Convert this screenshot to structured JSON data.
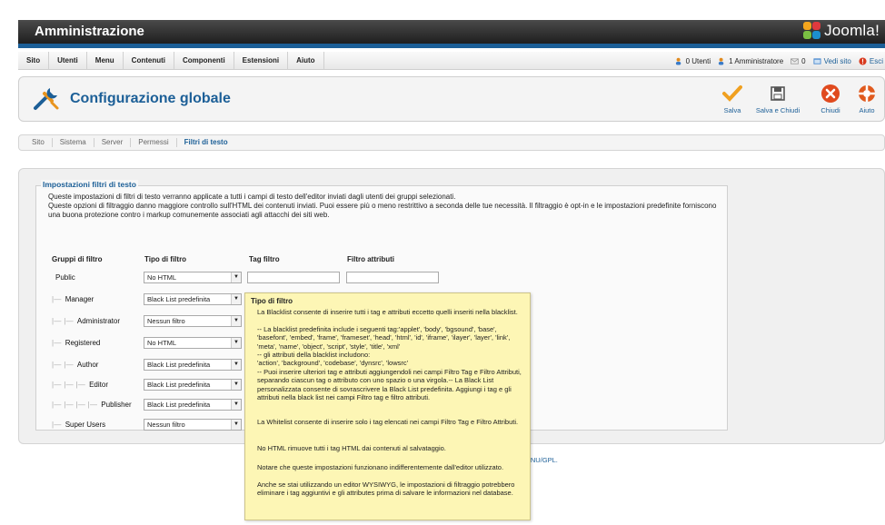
{
  "header": {
    "title": "Amministrazione",
    "logo_text": "Joomla!"
  },
  "menu": {
    "items": [
      "Sito",
      "Utenti",
      "Menu",
      "Contenuti",
      "Componenti",
      "Estensioni",
      "Aiuto"
    ],
    "status": {
      "users": "0 Utenti",
      "admins": "1 Amministratore",
      "messages": "0",
      "view_site": "Vedi sito",
      "logout": "Esci"
    }
  },
  "toolbar": {
    "page_title": "Configurazione globale",
    "save": "Salva",
    "save_close": "Salva e Chiudi",
    "close": "Chiudi",
    "help": "Aiuto"
  },
  "tabs": [
    "Sito",
    "Sistema",
    "Server",
    "Permessi",
    "Filtri di testo"
  ],
  "filters": {
    "legend": "Impostazioni filtri di testo",
    "description_1": "Queste impostazioni di filtri di testo verranno applicate a tutti i campi di testo dell'editor inviati dagli utenti dei gruppi selezionati.",
    "description_2": "Queste opzioni di filtraggio danno maggiore controllo sull'HTML dei contenuti inviati. Puoi essere più o meno restrittivo a seconda delle tue necessità. Il filtraggio è opt-in e le impostazioni predefinite forniscono una buona protezione contro i markup comunemente associati agli attacchi dei siti web.",
    "col_groups": "Gruppi di filtro",
    "col_type": "Tipo di filtro",
    "col_tags": "Tag filtro",
    "col_attrs": "Filtro attributi",
    "rows": [
      {
        "tree": "",
        "name": "Public",
        "type": "No HTML"
      },
      {
        "tree": "|—",
        "name": "Manager",
        "type": "Black List predefinita"
      },
      {
        "tree": "|— |—",
        "name": "Administrator",
        "type": "Nessun filtro"
      },
      {
        "tree": "|—",
        "name": "Registered",
        "type": "No HTML"
      },
      {
        "tree": "|— |—",
        "name": "Author",
        "type": "Black List predefinita"
      },
      {
        "tree": "|— |— |—",
        "name": "Editor",
        "type": "Black List predefinita"
      },
      {
        "tree": "|— |— |— |—",
        "name": "Publisher",
        "type": "Black List predefinita"
      },
      {
        "tree": "|—",
        "name": "Super Users",
        "type": "Nessun filtro"
      }
    ]
  },
  "footer": {
    "partial_text": "GNU/GPL."
  },
  "tooltip": {
    "title": "Tipo di filtro",
    "p1": "La Blacklist consente di inserire tutti i tag e attributi eccetto quelli inseriti nella blacklist.",
    "p2": "-- La blacklist predefinita include i seguenti tag:'applet', 'body', 'bgsound', 'base', 'basefont', 'embed', 'frame', 'frameset', 'head', 'html', 'id', 'iframe', 'ilayer', 'layer', 'link', 'meta', 'name', 'object', 'script', 'style', 'title', 'xml'",
    "p3": "-- gli attributi della blacklist includono:",
    "p4": "'action', 'background', 'codebase', 'dynsrc', 'lowsrc'",
    "p5": "-- Puoi inserire ulteriori tag e attributi aggiungendoli nei campi Filtro Tag e Filtro Attributi, separando ciascun tag o attributo con uno spazio o una virgola.-- La Black List personalizzata consente di sovrascrivere la Black List predefinita. Aggiungi i tag e gli attributi nella black list nei campi Filtro tag e filtro attributi.",
    "p6": "La Whitelist consente di inserire solo i tag elencati nei campi Filtro Tag e Filtro Attributi.",
    "p7": "No HTML rimuove tutti i tag HTML dai contenuti al salvataggio.",
    "p8": "Notare che queste impostazioni funzionano indifferentemente dall'editor utilizzato.",
    "p9": "Anche se stai utilizzando un editor WYSIWYG, le impostazioni di filtraggio potrebbero eliminare i tag aggiuntivi e gli attributes prima di salvare le informazioni nel database."
  },
  "colors": {
    "brand_blue": "#1c5f97",
    "header_dark": "#2b2b2b",
    "tooltip_bg": "#fdf6b5"
  }
}
